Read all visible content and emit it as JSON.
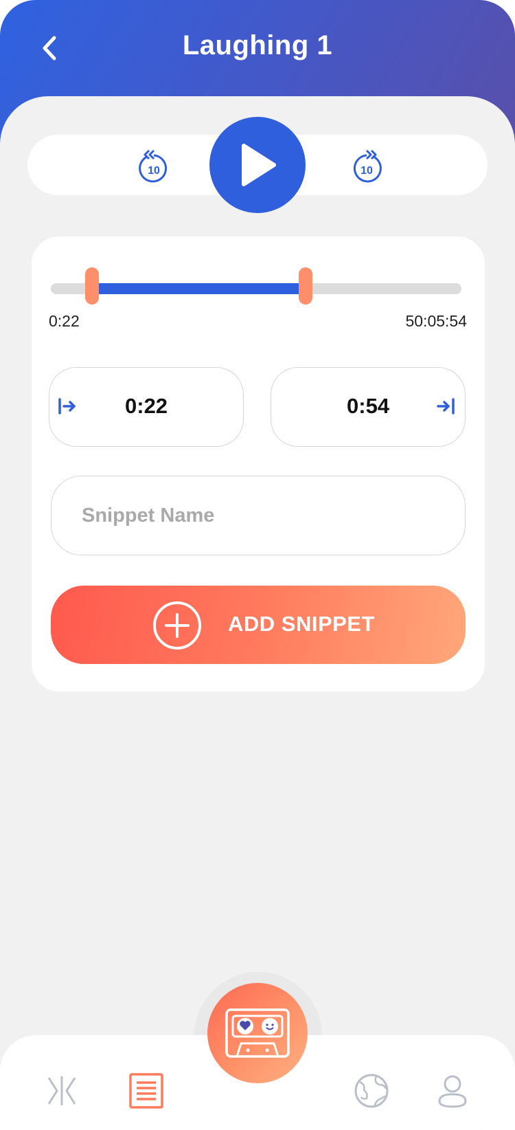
{
  "header": {
    "title": "Laughing 1"
  },
  "player": {
    "rewind_icon": "rewind-10-icon",
    "play_icon": "play-icon",
    "forward_icon": "forward-10-icon",
    "skip_seconds": "10"
  },
  "trim": {
    "range_start_fraction": 0.1,
    "range_end_fraction": 0.62,
    "total_start_label": "0:22",
    "total_end_label": "50:05:54",
    "start_time": "0:22",
    "end_time": "0:54"
  },
  "snippet": {
    "name_placeholder": "Snippet Name",
    "add_label": "ADD SNIPPET"
  },
  "nav": {
    "items": [
      "split-icon",
      "list-icon",
      "cassette-icon",
      "globe-icon",
      "profile-icon"
    ]
  },
  "colors": {
    "primary_blue": "#2f5fdc",
    "accent_orange": "#ff8e6a",
    "accent_red": "#ff5a4d",
    "inactive_gray": "#b9bec8"
  }
}
